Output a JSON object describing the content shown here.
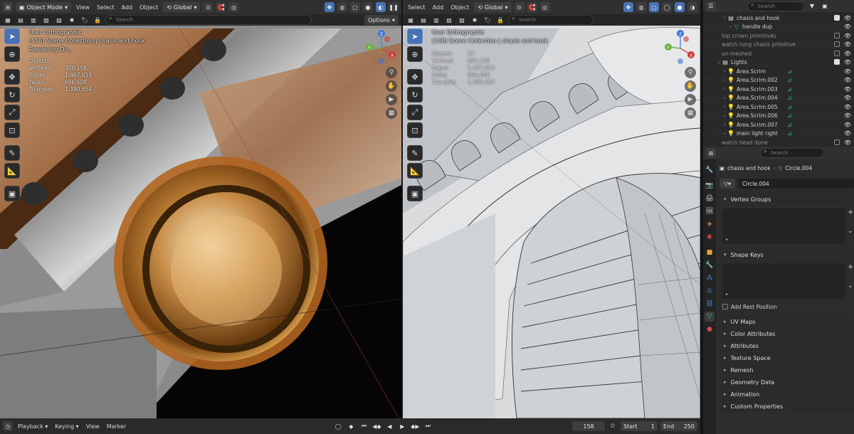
{
  "left_header": {
    "mode": "Object Mode",
    "menus": [
      "View",
      "Select",
      "Add",
      "Object"
    ],
    "transform": "Global"
  },
  "left_subheader": {
    "search_placeholder": "Search",
    "options": "Options"
  },
  "left_viewport": {
    "view_name": "User Orthographic",
    "collection": "(158) Scene Collection | chasis and hook",
    "status": "Rendering Do...",
    "stats": [
      {
        "k": "Objects",
        "v": ""
      },
      {
        "k": "Vertices",
        "v": "306,158"
      },
      {
        "k": "Edges",
        "v": "1,467,619"
      },
      {
        "k": "Faces",
        "v": "696,608"
      },
      {
        "k": "Triangles",
        "v": "1,380,654"
      }
    ]
  },
  "right_header": {
    "menus": [
      "Select",
      "Add",
      "Object"
    ],
    "transform": "Global",
    "search_placeholder": "Search"
  },
  "right_viewport": {
    "view_name": "User Orthographic",
    "collection": "(158) Scene Collection | chasis and hook",
    "stats": [
      {
        "k": "Objects",
        "v": "27"
      },
      {
        "k": "Vertices",
        "v": "654,158"
      },
      {
        "k": "Edges",
        "v": "1,467,619"
      },
      {
        "k": "Faces",
        "v": "696,608"
      },
      {
        "k": "Triangles",
        "v": "1,380,654"
      }
    ]
  },
  "outliner": {
    "search_placeholder": "Search",
    "rows": [
      {
        "label": "chasis and hook",
        "indent": 2,
        "icon": "collection",
        "alt": false
      },
      {
        "label": "handle dup",
        "indent": 3,
        "icon": "mesh",
        "alt": true
      },
      {
        "label": "top crown primitives",
        "indent": 1,
        "icon": "none",
        "alt": false
      },
      {
        "label": "watch rung chasis primitive",
        "indent": 1,
        "icon": "none",
        "alt": true
      },
      {
        "label": "un-meshed",
        "indent": 1,
        "icon": "none",
        "alt": false
      },
      {
        "label": "Lights",
        "indent": 1,
        "icon": "collection",
        "alt": true
      },
      {
        "label": "Area.Scrim",
        "indent": 2,
        "icon": "light",
        "alt": false
      },
      {
        "label": "Area.Scrim.002",
        "indent": 2,
        "icon": "light",
        "alt": true
      },
      {
        "label": "Area.Scrim.003",
        "indent": 2,
        "icon": "light",
        "alt": false
      },
      {
        "label": "Area.Scrim.004",
        "indent": 2,
        "icon": "light",
        "alt": true
      },
      {
        "label": "Area.Scrim.005",
        "indent": 2,
        "icon": "light",
        "alt": false
      },
      {
        "label": "Area.Scrim.006",
        "indent": 2,
        "icon": "light",
        "alt": true
      },
      {
        "label": "Area.Scrim.007",
        "indent": 2,
        "icon": "light",
        "alt": false
      },
      {
        "label": "main light right",
        "indent": 2,
        "icon": "light",
        "alt": true
      },
      {
        "label": "watch head done",
        "indent": 1,
        "icon": "none",
        "alt": false
      }
    ]
  },
  "properties": {
    "search_placeholder": "Search",
    "breadcrumb_object": "chasis and hook",
    "breadcrumb_data": "Circle.004",
    "data_name": "Circle.004",
    "panels": {
      "vertex_groups": "Vertex Groups",
      "shape_keys": "Shape Keys",
      "add_rest_position": "Add Rest Position",
      "uv_maps": "UV Maps",
      "color_attributes": "Color Attributes",
      "attributes": "Attributes",
      "texture_space": "Texture Space",
      "remesh": "Remesh",
      "geometry_data": "Geometry Data",
      "animation": "Animation",
      "custom_properties": "Custom Properties"
    }
  },
  "timeline": {
    "menus": [
      "Playback",
      "Keying",
      "View",
      "Marker"
    ],
    "current_frame": "158",
    "start_label": "Start",
    "start_value": "1",
    "end_label": "End",
    "end_value": "250"
  },
  "colors": {
    "accent": "#4772b3",
    "light_icon": "#e8a53a",
    "mesh_icon": "#3fbf6f"
  }
}
